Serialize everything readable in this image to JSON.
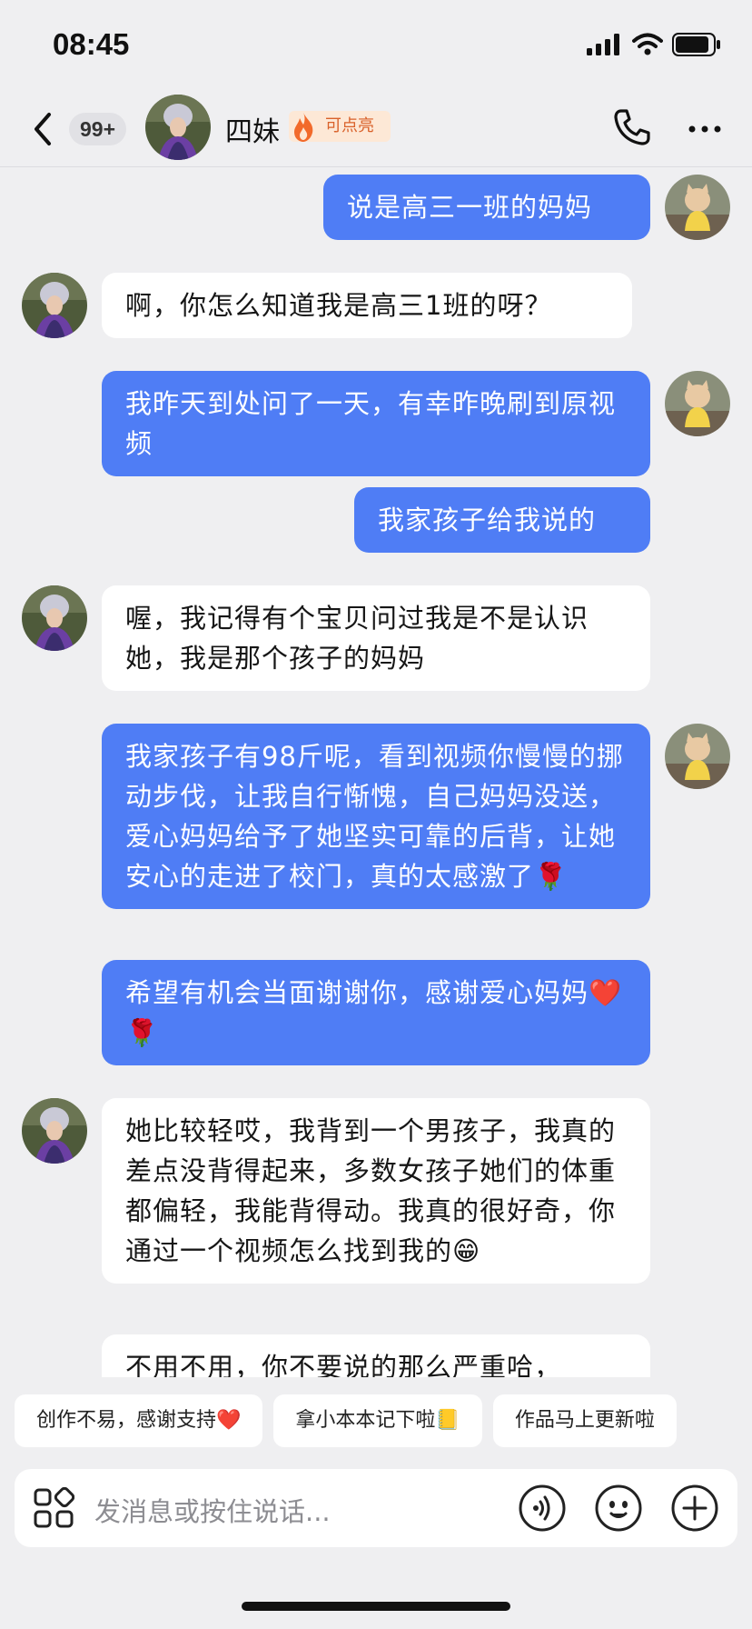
{
  "status_bar": {
    "time": "08:45"
  },
  "header": {
    "unread_count": "99+",
    "contact_name": "四妹",
    "spark_label": "可点亮"
  },
  "messages": [
    {
      "side": "out",
      "text": "说是高三一班的妈妈"
    },
    {
      "side": "in",
      "text": "啊，你怎么知道我是高三1班的呀？"
    },
    {
      "side": "out",
      "text": "我昨天到处问了一天，有幸昨晚刷到原视频"
    },
    {
      "side": "out",
      "text": "我家孩子给我说的"
    },
    {
      "side": "in",
      "text": "喔，我记得有个宝贝问过我是不是认识她，我是那个孩子的妈妈"
    },
    {
      "side": "out",
      "text": "我家孩子有98斤呢，看到视频你慢慢的挪动步伐，让我自行惭愧，自己妈妈没送，爱心妈妈给予了她坚实可靠的后背，让她安心的走进了校门，真的太感激了🌹"
    },
    {
      "side": "out",
      "text": "希望有机会当面谢谢你，感谢爱心妈妈❤️🌹"
    },
    {
      "side": "in",
      "text": "她比较轻哎，我背到一个男孩子，我真的差点没背得起来，多数女孩子她们的体重都偏轻，我能背得动。我真的很好奇，你通过一个视频怎么找到我的😁"
    },
    {
      "side": "in",
      "text": "不用不用，你不要说的那么严重哈，"
    }
  ],
  "quick_replies": [
    "创作不易，感谢支持❤️",
    "拿小本本记下啦📒",
    "作品马上更新啦"
  ],
  "input": {
    "placeholder": "发消息或按住说话..."
  },
  "colors": {
    "background": "#efeff1",
    "outgoing_bubble": "#4f7df5",
    "incoming_bubble": "#ffffff",
    "spark_text": "#d9612a"
  },
  "icons": [
    "back-arrow-icon",
    "fire-icon",
    "phone-icon",
    "more-icon",
    "apps-grid-icon",
    "voice-icon",
    "emoji-icon",
    "plus-icon"
  ]
}
